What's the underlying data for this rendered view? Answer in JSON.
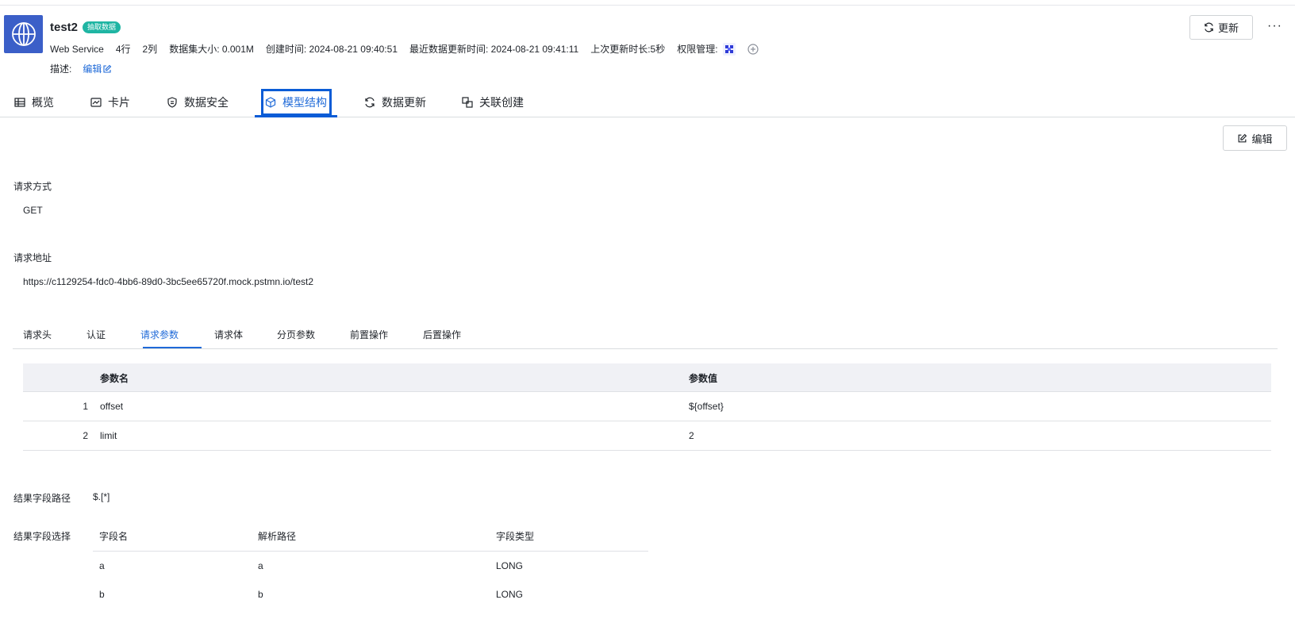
{
  "header": {
    "title": "test2",
    "badge": "抽取数据",
    "meta": {
      "source": "Web Service",
      "rows": "4行",
      "cols": "2列",
      "size": "数据集大小: 0.001M",
      "created": "创建时间: 2024-08-21 09:40:51",
      "recent_update": "最近数据更新时间: 2024-08-21 09:41:11",
      "last_duration": "上次更新时长:5秒",
      "permission_label": "权限管理:"
    },
    "desc_label": "描述:",
    "desc_edit": "编辑",
    "update_button": "更新",
    "more": "···"
  },
  "tabs": [
    {
      "label": "概览",
      "icon": "table-icon"
    },
    {
      "label": "卡片",
      "icon": "chart-card-icon"
    },
    {
      "label": "数据安全",
      "icon": "shield-icon"
    },
    {
      "label": "模型结构",
      "icon": "cube-icon",
      "active": true
    },
    {
      "label": "数据更新",
      "icon": "refresh-icon"
    },
    {
      "label": "关联创建",
      "icon": "link-create-icon"
    }
  ],
  "edit_button": "编辑",
  "request": {
    "method_label": "请求方式",
    "method": "GET",
    "url_label": "请求地址",
    "url": "https://c1129254-fdc0-4bb6-89d0-3bc5ee65720f.mock.pstmn.io/test2"
  },
  "subtabs": [
    "请求头",
    "认证",
    "请求参数",
    "请求体",
    "分页参数",
    "前置操作",
    "后置操作"
  ],
  "subtab_active": "请求参数",
  "params_table": {
    "headers": [
      "参数名",
      "参数值"
    ],
    "rows": [
      {
        "index": "1",
        "name": "offset",
        "value": "${offset}"
      },
      {
        "index": "2",
        "name": "limit",
        "value": "2"
      }
    ]
  },
  "result": {
    "path_label": "结果字段路径",
    "path": "$.[*]",
    "select_label": "结果字段选择",
    "headers": [
      "字段名",
      "解析路径",
      "字段类型"
    ],
    "rows": [
      {
        "field": "a",
        "path": "a",
        "type": "LONG"
      },
      {
        "field": "b",
        "path": "b",
        "type": "LONG"
      }
    ]
  },
  "colors": {
    "accent": "#1f6ad8",
    "badge": "#1fb5a3",
    "icon_bg": "#3b5fc8"
  }
}
